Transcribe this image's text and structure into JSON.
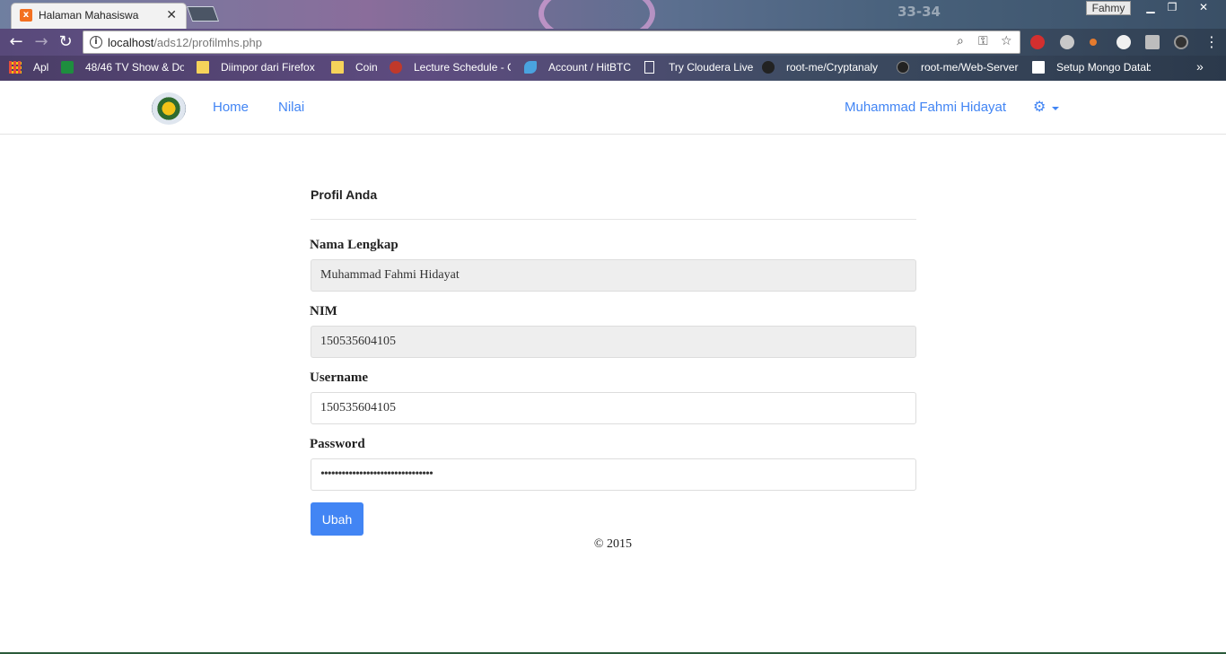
{
  "browser": {
    "tab_title": "Halaman Mahasiswa",
    "profile_name": "Fahmy",
    "url_host": "localhost",
    "url_path": "/ads12/profilmhs.php",
    "decor_text": "33-34",
    "bookmarks": [
      {
        "label": "Apl",
        "icon": "apps-grid-icon"
      },
      {
        "label": "48/46 TV Show & Do",
        "icon": "sheets-icon"
      },
      {
        "label": "Diimpor dari Firefox",
        "icon": "folder-icon"
      },
      {
        "label": "Coin",
        "icon": "folder-icon"
      },
      {
        "label": "Lecture Schedule - C",
        "icon": "apple-icon"
      },
      {
        "label": "Account / HitBTC",
        "icon": "shark-icon"
      },
      {
        "label": "Try Cloudera Live",
        "icon": "page-icon"
      },
      {
        "label": "root-me/Cryptanaly",
        "icon": "bird-icon"
      },
      {
        "label": "root-me/Web-Server",
        "icon": "github-icon"
      },
      {
        "label": "Setup Mongo Datab",
        "icon": "page-icon"
      }
    ],
    "more_bookmarks": "»"
  },
  "nav": {
    "links": [
      "Home",
      "Nilai"
    ],
    "user_name": "Muhammad Fahmi Hidayat"
  },
  "profile": {
    "title": "Profil Anda",
    "fields": [
      {
        "label": "Nama Lengkap",
        "value": "Muhammad Fahmi Hidayat",
        "readonly": true
      },
      {
        "label": "NIM",
        "value": "150535604105",
        "readonly": true
      },
      {
        "label": "Username",
        "value": "150535604105",
        "readonly": false
      },
      {
        "label": "Password",
        "value": "••••••••••••••••••••••••••••••••",
        "readonly": false
      }
    ],
    "submit_label": "Ubah"
  },
  "footer": "© 2015",
  "colors": {
    "accent": "#4285f4",
    "readonly_bg": "#eeeeee"
  }
}
